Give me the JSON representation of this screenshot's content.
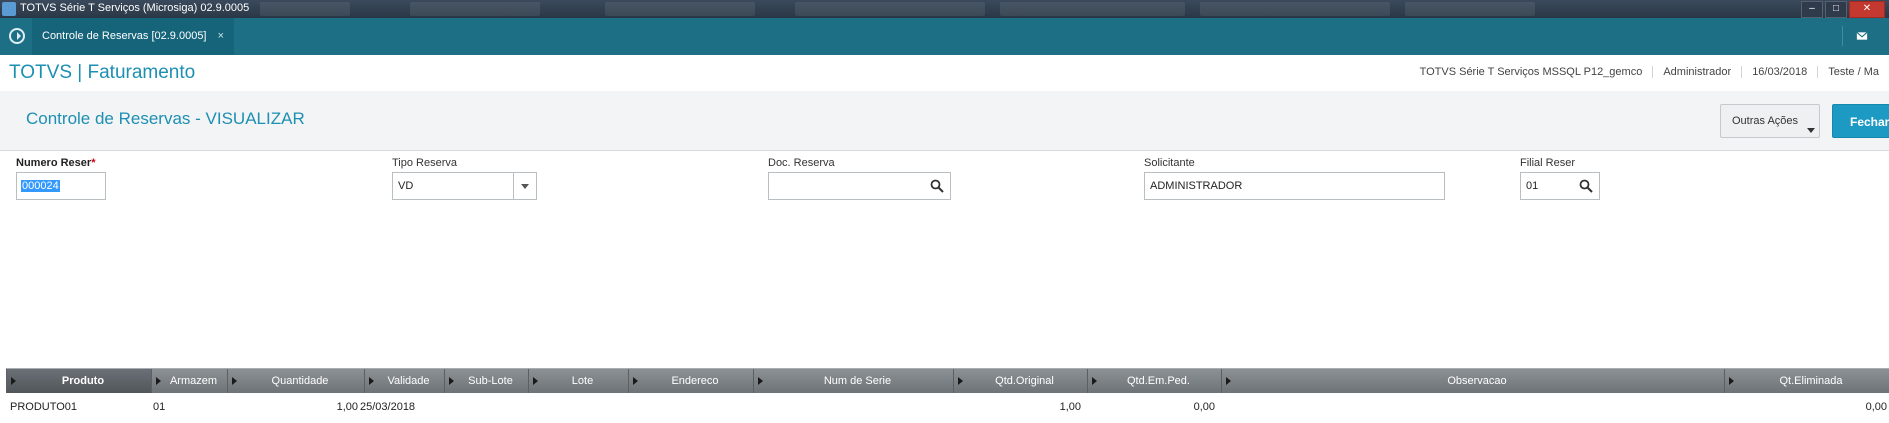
{
  "window": {
    "title": "TOTVS Série T Serviços (Microsiga) 02.9.0005"
  },
  "tabbar": {
    "tab_label": "Controle de Reservas [02.9.0005]",
    "tab_close": "×"
  },
  "module": {
    "title": "TOTVS | Faturamento",
    "environment": "TOTVS Série T Serviços MSSQL P12_gemco",
    "user": "Administrador",
    "date": "16/03/2018",
    "company": "Teste / Ma"
  },
  "screen": {
    "title": "Controle de Reservas - VISUALIZAR",
    "other_actions_label": "Outras Ações",
    "close_label": "Fechar"
  },
  "form": {
    "numero_reserva": {
      "label": "Numero Reser",
      "required_mark": "*",
      "value": "000024"
    },
    "tipo_reserva": {
      "label": "Tipo Reserva",
      "value": "VD"
    },
    "doc_reserva": {
      "label": "Doc. Reserva",
      "value": ""
    },
    "solicitante": {
      "label": "Solicitante",
      "value": "ADMINISTRADOR"
    },
    "filial_reserva": {
      "label": "Filial Reser",
      "value": "01"
    }
  },
  "grid": {
    "columns": [
      "Produto",
      "Armazem",
      "Quantidade",
      "Validade",
      "Sub-Lote",
      "Lote",
      "Endereco",
      "Num de Serie",
      "Qtd.Original",
      "Qtd.Em.Ped.",
      "Observacao",
      "Qt.Eliminada"
    ],
    "rows": [
      [
        "PRODUTO01",
        "01",
        "1,00",
        "25/03/2018",
        "",
        "",
        "",
        "",
        "1,00",
        "0,00",
        "",
        "0,00"
      ]
    ]
  },
  "colors": {
    "accent": "#1d8fb3",
    "tabbar": "#1d6f86",
    "primary_button": "#1c9ac4",
    "selection": "#3399ff"
  }
}
